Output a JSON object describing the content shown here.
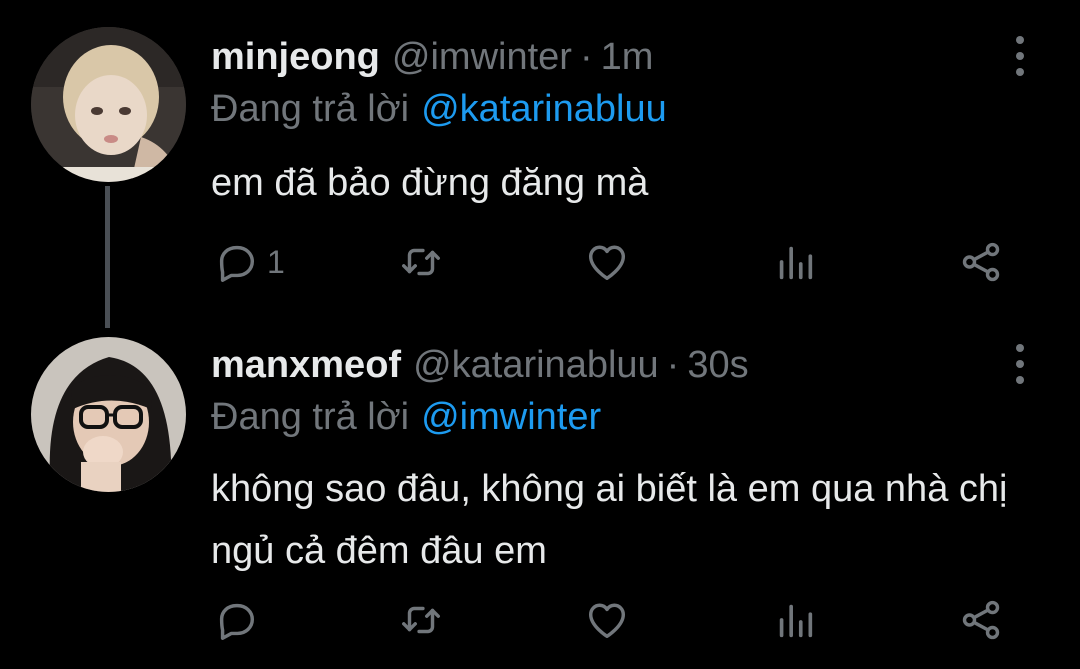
{
  "tweets": [
    {
      "display_name": "minjeong",
      "handle": "@imwinter",
      "separator": "·",
      "time": "1m",
      "reply_prefix": "Đang trả lời",
      "reply_to": "@katarinabluu",
      "text": "em đã bảo đừng đăng mà",
      "reply_count": "1",
      "avatar_icon": "blonde-person-avatar"
    },
    {
      "display_name": "manxmeof",
      "handle": "@katarinabluu",
      "separator": "·",
      "time": "30s",
      "reply_prefix": "Đang trả lời",
      "reply_to": "@imwinter",
      "text": "không sao đâu, không ai biết là em qua nhà chị ngủ cả đêm đâu em",
      "reply_count": "",
      "avatar_icon": "glasses-person-avatar"
    }
  ],
  "icons": {
    "reply": "reply-icon",
    "retweet": "retweet-icon",
    "like": "heart-icon",
    "views": "views-icon",
    "share": "share-icon",
    "more": "more-vertical-icon"
  },
  "colors": {
    "background": "#000000",
    "text": "#e7e9ea",
    "secondary": "#71767b",
    "mention": "#1d9bf0",
    "thread_line": "#4a4f55"
  }
}
